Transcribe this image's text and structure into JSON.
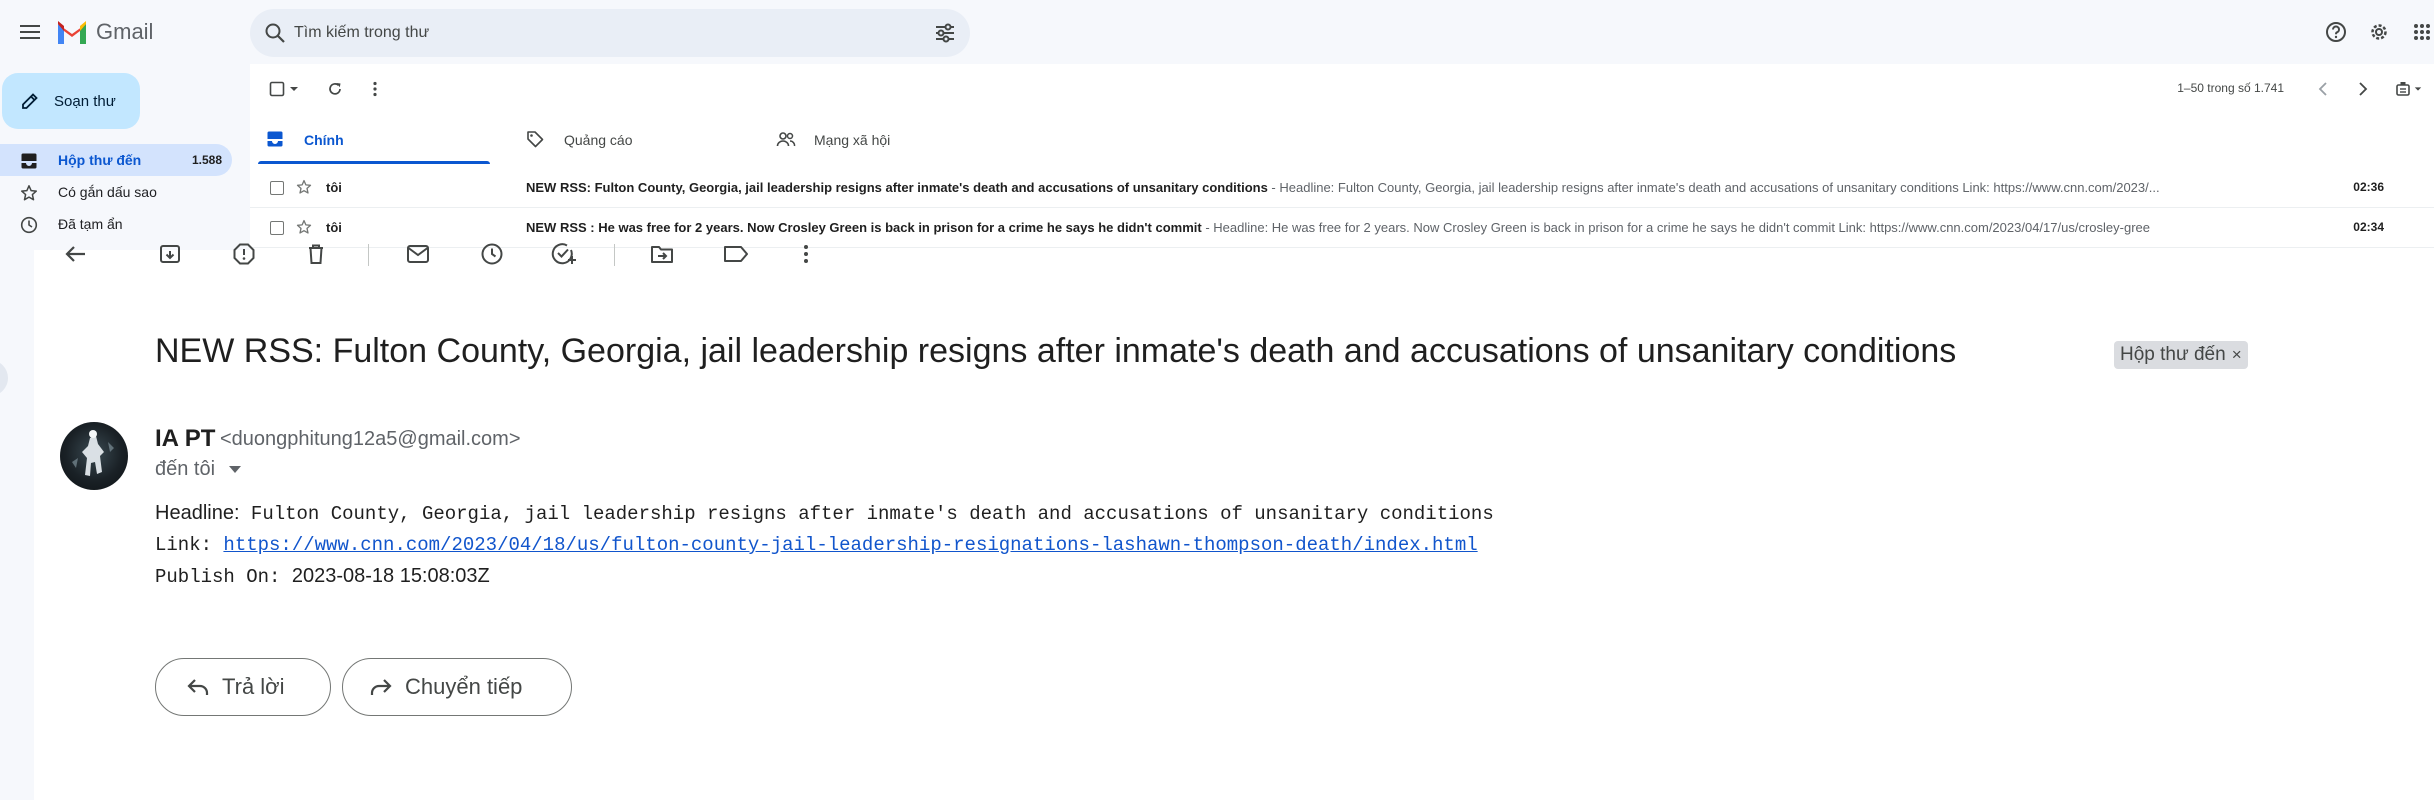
{
  "header": {
    "app_name": "Gmail",
    "search_placeholder": "Tìm kiếm trong thư"
  },
  "sidebar": {
    "compose_label": "Soạn thư",
    "items": [
      {
        "label": "Hộp thư đến",
        "count": "1.588",
        "icon": "inbox-icon",
        "active": true
      },
      {
        "label": "Có gắn dấu sao",
        "count": "",
        "icon": "star-icon",
        "active": false
      },
      {
        "label": "Đã tạm ẩn",
        "count": "",
        "icon": "clock-icon",
        "active": false
      }
    ]
  },
  "list": {
    "pager_text": "1–50 trong số 1.741",
    "tabs": [
      {
        "label": "Chính",
        "icon": "inbox-icon",
        "active": true
      },
      {
        "label": "Quảng cáo",
        "icon": "tag-icon",
        "active": false
      },
      {
        "label": "Mạng xã hội",
        "icon": "people-icon",
        "active": false
      }
    ],
    "rows": [
      {
        "sender": "tôi",
        "subject": "NEW RSS: Fulton County, Georgia, jail leadership resigns after inmate's death and accusations of unsanitary conditions",
        "snippet": " - Headline: Fulton County, Georgia, jail leadership resigns after inmate's death and accusations of unsanitary conditions Link: https://www.cnn.com/2023/...",
        "time": "02:36"
      },
      {
        "sender": "tôi",
        "subject": "NEW RSS : He was free for 2 years. Now Crosley Green is back in prison for a crime he says he didn't commit",
        "snippet": " - Headline: He was free for 2 years. Now Crosley Green is back in prison for a crime he says he didn't commit Link: https://www.cnn.com/2023/04/17/us/crosley-gree",
        "time": "02:34"
      }
    ]
  },
  "message": {
    "subject": "NEW RSS: Fulton County, Georgia, jail leadership resigns after inmate's death and accusations of unsanitary conditions",
    "label": "Hộp thư đến",
    "label_close": "×",
    "sender_name": "IA PT",
    "sender_email": "<duongphitung12a5@gmail.com>",
    "recipient": "đến tôi",
    "headline_label": "Headline:",
    "headline_text": " Fulton County, Georgia, jail leadership resigns after inmate's death and accusations of unsanitary conditions",
    "link_label": "Link: ",
    "link_url": "https://www.cnn.com/2023/04/18/us/fulton-county-jail-leadership-resignations-lashawn-thompson-death/index.html",
    "publish_label": "Publish On: ",
    "publish_value": "2023-08-18 15:08:03Z",
    "reply_label": "Trả lời",
    "forward_label": "Chuyển tiếp"
  },
  "colors": {
    "accent": "#0b57d0",
    "compose_bg": "#c2e7ff",
    "active_nav_bg": "#d3e3fd",
    "link": "#1155cc"
  }
}
